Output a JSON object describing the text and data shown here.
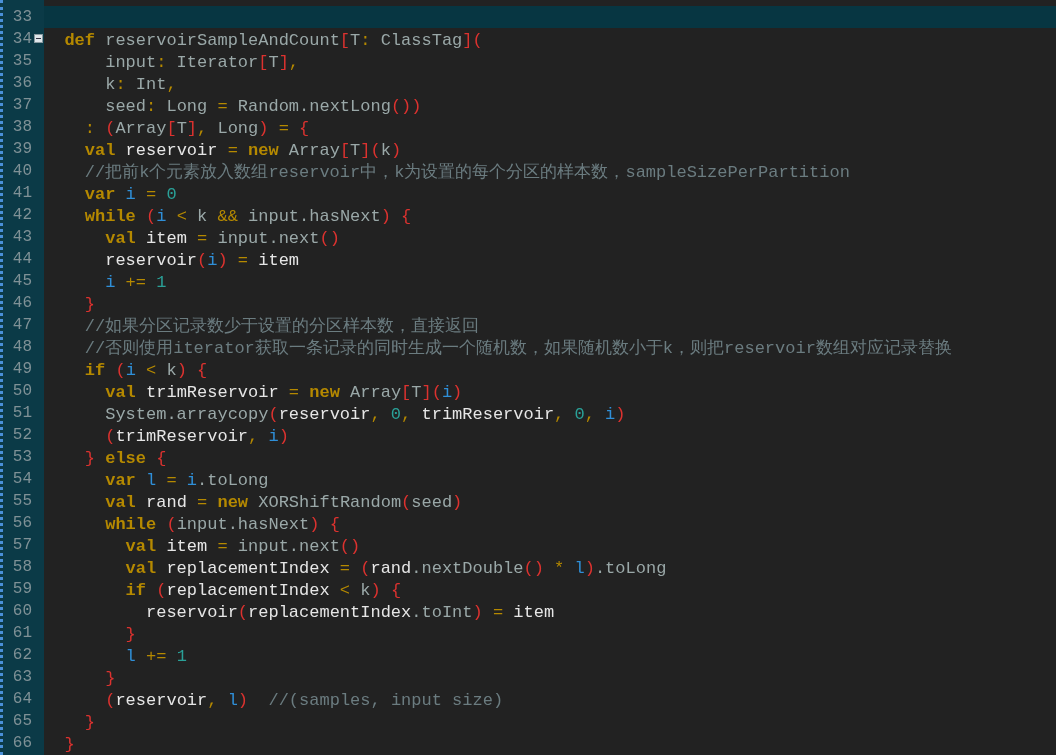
{
  "editor": {
    "lines": [
      {
        "number": "33",
        "current": true
      },
      {
        "number": "34",
        "current": false,
        "foldable": true,
        "tokens": [
          {
            "kind": "keyword",
            "text": "  def"
          },
          {
            "kind": "ident",
            "text": " reservoirSampleAndCount"
          },
          {
            "kind": "bracket",
            "text": "["
          },
          {
            "kind": "ident",
            "text": "T"
          },
          {
            "kind": "operator",
            "text": ":"
          },
          {
            "kind": "ident",
            "text": " ClassTag"
          },
          {
            "kind": "bracket",
            "text": "]("
          }
        ]
      },
      {
        "number": "35",
        "current": false,
        "tokens": [
          {
            "kind": "ident",
            "text": "      input"
          },
          {
            "kind": "operator",
            "text": ":"
          },
          {
            "kind": "ident",
            "text": " Iterator"
          },
          {
            "kind": "bracket",
            "text": "["
          },
          {
            "kind": "ident",
            "text": "T"
          },
          {
            "kind": "bracket",
            "text": "]"
          },
          {
            "kind": "operator",
            "text": ","
          }
        ]
      },
      {
        "number": "36",
        "current": false,
        "tokens": [
          {
            "kind": "ident",
            "text": "      k"
          },
          {
            "kind": "operator",
            "text": ":"
          },
          {
            "kind": "ident",
            "text": " Int"
          },
          {
            "kind": "operator",
            "text": ","
          }
        ]
      },
      {
        "number": "37",
        "current": false,
        "tokens": [
          {
            "kind": "ident",
            "text": "      seed"
          },
          {
            "kind": "operator",
            "text": ":"
          },
          {
            "kind": "ident",
            "text": " Long "
          },
          {
            "kind": "operator",
            "text": "="
          },
          {
            "kind": "ident",
            "text": " Random.nextLong"
          },
          {
            "kind": "bracket",
            "text": "())"
          }
        ]
      },
      {
        "number": "38",
        "current": false,
        "tokens": [
          {
            "kind": "operator",
            "text": "    :"
          },
          {
            "kind": "bracket",
            "text": " ("
          },
          {
            "kind": "ident",
            "text": "Array"
          },
          {
            "kind": "bracket",
            "text": "["
          },
          {
            "kind": "ident",
            "text": "T"
          },
          {
            "kind": "bracket",
            "text": "]"
          },
          {
            "kind": "operator",
            "text": ","
          },
          {
            "kind": "ident",
            "text": " Long"
          },
          {
            "kind": "bracket",
            "text": ")"
          },
          {
            "kind": "operator",
            "text": " ="
          },
          {
            "kind": "bracket",
            "text": " {"
          }
        ]
      },
      {
        "number": "39",
        "current": false,
        "tokens": [
          {
            "kind": "keyword",
            "text": "    val"
          },
          {
            "kind": "value",
            "text": " reservoir "
          },
          {
            "kind": "operator",
            "text": "="
          },
          {
            "kind": "keyword",
            "text": " new"
          },
          {
            "kind": "ident",
            "text": " Array"
          },
          {
            "kind": "bracket",
            "text": "["
          },
          {
            "kind": "ident",
            "text": "T"
          },
          {
            "kind": "bracket",
            "text": "]("
          },
          {
            "kind": "ident",
            "text": "k"
          },
          {
            "kind": "bracket",
            "text": ")"
          }
        ]
      },
      {
        "number": "40",
        "current": false,
        "tokens": [
          {
            "kind": "comment",
            "text": "    //把前k个元素放入数组reservoir中，k为设置的每个分区的样本数，sampleSizePerPartition"
          }
        ]
      },
      {
        "number": "41",
        "current": false,
        "tokens": [
          {
            "kind": "keyword",
            "text": "    var"
          },
          {
            "kind": "local",
            "text": " i "
          },
          {
            "kind": "operator",
            "text": "="
          },
          {
            "kind": "number",
            "text": " 0"
          }
        ]
      },
      {
        "number": "42",
        "current": false,
        "tokens": [
          {
            "kind": "keyword",
            "text": "    while"
          },
          {
            "kind": "bracket",
            "text": " ("
          },
          {
            "kind": "local",
            "text": "i"
          },
          {
            "kind": "operator",
            "text": " <"
          },
          {
            "kind": "ident",
            "text": " k "
          },
          {
            "kind": "operator",
            "text": "&&"
          },
          {
            "kind": "ident",
            "text": " input.hasNext"
          },
          {
            "kind": "bracket",
            "text": ")"
          },
          {
            "kind": "bracket",
            "text": " {"
          }
        ]
      },
      {
        "number": "43",
        "current": false,
        "tokens": [
          {
            "kind": "keyword",
            "text": "      val"
          },
          {
            "kind": "value",
            "text": " item "
          },
          {
            "kind": "operator",
            "text": "="
          },
          {
            "kind": "ident",
            "text": " input.next"
          },
          {
            "kind": "bracket",
            "text": "()"
          }
        ]
      },
      {
        "number": "44",
        "current": false,
        "tokens": [
          {
            "kind": "value",
            "text": "      reservoir"
          },
          {
            "kind": "bracket",
            "text": "("
          },
          {
            "kind": "local",
            "text": "i"
          },
          {
            "kind": "bracket",
            "text": ")"
          },
          {
            "kind": "operator",
            "text": " ="
          },
          {
            "kind": "value",
            "text": " item"
          }
        ]
      },
      {
        "number": "45",
        "current": false,
        "tokens": [
          {
            "kind": "local",
            "text": "      i"
          },
          {
            "kind": "operator",
            "text": " +="
          },
          {
            "kind": "number",
            "text": " 1"
          }
        ]
      },
      {
        "number": "46",
        "current": false,
        "tokens": [
          {
            "kind": "bracket",
            "text": "    }"
          }
        ]
      },
      {
        "number": "47",
        "current": false,
        "tokens": [
          {
            "kind": "comment",
            "text": "    //如果分区记录数少于设置的分区样本数，直接返回"
          }
        ]
      },
      {
        "number": "48",
        "current": false,
        "tokens": [
          {
            "kind": "comment",
            "text": "    //否则使用iterator获取一条记录的同时生成一个随机数，如果随机数小于k，则把reservoir数组对应记录替换"
          }
        ]
      },
      {
        "number": "49",
        "current": false,
        "tokens": [
          {
            "kind": "keyword",
            "text": "    if"
          },
          {
            "kind": "bracket",
            "text": " ("
          },
          {
            "kind": "local",
            "text": "i"
          },
          {
            "kind": "operator",
            "text": " <"
          },
          {
            "kind": "ident",
            "text": " k"
          },
          {
            "kind": "bracket",
            "text": ")"
          },
          {
            "kind": "bracket",
            "text": " {"
          }
        ]
      },
      {
        "number": "50",
        "current": false,
        "tokens": [
          {
            "kind": "keyword",
            "text": "      val"
          },
          {
            "kind": "value",
            "text": " trimReservoir "
          },
          {
            "kind": "operator",
            "text": "="
          },
          {
            "kind": "keyword",
            "text": " new"
          },
          {
            "kind": "ident",
            "text": " Array"
          },
          {
            "kind": "bracket",
            "text": "["
          },
          {
            "kind": "ident",
            "text": "T"
          },
          {
            "kind": "bracket",
            "text": "]("
          },
          {
            "kind": "local",
            "text": "i"
          },
          {
            "kind": "bracket",
            "text": ")"
          }
        ]
      },
      {
        "number": "51",
        "current": false,
        "tokens": [
          {
            "kind": "ident",
            "text": "      System.arraycopy"
          },
          {
            "kind": "bracket",
            "text": "("
          },
          {
            "kind": "value",
            "text": "reservoir"
          },
          {
            "kind": "operator",
            "text": ","
          },
          {
            "kind": "number",
            "text": " 0"
          },
          {
            "kind": "operator",
            "text": ","
          },
          {
            "kind": "value",
            "text": " trimReservoir"
          },
          {
            "kind": "operator",
            "text": ","
          },
          {
            "kind": "number",
            "text": " 0"
          },
          {
            "kind": "operator",
            "text": ","
          },
          {
            "kind": "local",
            "text": " i"
          },
          {
            "kind": "bracket",
            "text": ")"
          }
        ]
      },
      {
        "number": "52",
        "current": false,
        "tokens": [
          {
            "kind": "bracket",
            "text": "      ("
          },
          {
            "kind": "value",
            "text": "trimReservoir"
          },
          {
            "kind": "operator",
            "text": ","
          },
          {
            "kind": "local",
            "text": " i"
          },
          {
            "kind": "bracket",
            "text": ")"
          }
        ]
      },
      {
        "number": "53",
        "current": false,
        "tokens": [
          {
            "kind": "bracket",
            "text": "    }"
          },
          {
            "kind": "keyword",
            "text": " else"
          },
          {
            "kind": "bracket",
            "text": " {"
          }
        ]
      },
      {
        "number": "54",
        "current": false,
        "tokens": [
          {
            "kind": "keyword",
            "text": "      var"
          },
          {
            "kind": "local",
            "text": " l "
          },
          {
            "kind": "operator",
            "text": "="
          },
          {
            "kind": "local",
            "text": " i"
          },
          {
            "kind": "ident",
            "text": ".toLong"
          }
        ]
      },
      {
        "number": "55",
        "current": false,
        "tokens": [
          {
            "kind": "keyword",
            "text": "      val"
          },
          {
            "kind": "value",
            "text": " rand "
          },
          {
            "kind": "operator",
            "text": "="
          },
          {
            "kind": "keyword",
            "text": " new"
          },
          {
            "kind": "ident",
            "text": " XORShiftRandom"
          },
          {
            "kind": "bracket",
            "text": "("
          },
          {
            "kind": "ident",
            "text": "seed"
          },
          {
            "kind": "bracket",
            "text": ")"
          }
        ]
      },
      {
        "number": "56",
        "current": false,
        "tokens": [
          {
            "kind": "keyword",
            "text": "      while"
          },
          {
            "kind": "bracket",
            "text": " ("
          },
          {
            "kind": "ident",
            "text": "input.hasNext"
          },
          {
            "kind": "bracket",
            "text": ")"
          },
          {
            "kind": "bracket",
            "text": " {"
          }
        ]
      },
      {
        "number": "57",
        "current": false,
        "tokens": [
          {
            "kind": "keyword",
            "text": "        val"
          },
          {
            "kind": "value",
            "text": " item "
          },
          {
            "kind": "operator",
            "text": "="
          },
          {
            "kind": "ident",
            "text": " input.next"
          },
          {
            "kind": "bracket",
            "text": "()"
          }
        ]
      },
      {
        "number": "58",
        "current": false,
        "tokens": [
          {
            "kind": "keyword",
            "text": "        val"
          },
          {
            "kind": "value",
            "text": " replacementIndex "
          },
          {
            "kind": "operator",
            "text": "="
          },
          {
            "kind": "bracket",
            "text": " ("
          },
          {
            "kind": "value",
            "text": "rand"
          },
          {
            "kind": "ident",
            "text": ".nextDouble"
          },
          {
            "kind": "bracket",
            "text": "()"
          },
          {
            "kind": "operator",
            "text": " *"
          },
          {
            "kind": "local",
            "text": " l"
          },
          {
            "kind": "bracket",
            "text": ")"
          },
          {
            "kind": "ident",
            "text": ".toLong"
          }
        ]
      },
      {
        "number": "59",
        "current": false,
        "tokens": [
          {
            "kind": "keyword",
            "text": "        if"
          },
          {
            "kind": "bracket",
            "text": " ("
          },
          {
            "kind": "value",
            "text": "replacementIndex"
          },
          {
            "kind": "operator",
            "text": " <"
          },
          {
            "kind": "ident",
            "text": " k"
          },
          {
            "kind": "bracket",
            "text": ")"
          },
          {
            "kind": "bracket",
            "text": " {"
          }
        ]
      },
      {
        "number": "60",
        "current": false,
        "tokens": [
          {
            "kind": "value",
            "text": "          reservoir"
          },
          {
            "kind": "bracket",
            "text": "("
          },
          {
            "kind": "value",
            "text": "replacementIndex"
          },
          {
            "kind": "ident",
            "text": ".toInt"
          },
          {
            "kind": "bracket",
            "text": ")"
          },
          {
            "kind": "operator",
            "text": " ="
          },
          {
            "kind": "value",
            "text": " item"
          }
        ]
      },
      {
        "number": "61",
        "current": false,
        "tokens": [
          {
            "kind": "bracket",
            "text": "        }"
          }
        ]
      },
      {
        "number": "62",
        "current": false,
        "tokens": [
          {
            "kind": "local",
            "text": "        l"
          },
          {
            "kind": "operator",
            "text": " +="
          },
          {
            "kind": "number",
            "text": " 1"
          }
        ]
      },
      {
        "number": "63",
        "current": false,
        "tokens": [
          {
            "kind": "bracket",
            "text": "      }"
          }
        ]
      },
      {
        "number": "64",
        "current": false,
        "tokens": [
          {
            "kind": "bracket",
            "text": "      ("
          },
          {
            "kind": "value",
            "text": "reservoir"
          },
          {
            "kind": "operator",
            "text": ","
          },
          {
            "kind": "local",
            "text": " l"
          },
          {
            "kind": "bracket",
            "text": ")"
          },
          {
            "kind": "comment",
            "text": "  //(samples, input size)"
          }
        ]
      },
      {
        "number": "65",
        "current": false,
        "tokens": [
          {
            "kind": "bracket",
            "text": "    }"
          }
        ]
      },
      {
        "number": "66",
        "current": false,
        "tokens": [
          {
            "kind": "bracket",
            "text": "  }"
          }
        ]
      }
    ]
  }
}
